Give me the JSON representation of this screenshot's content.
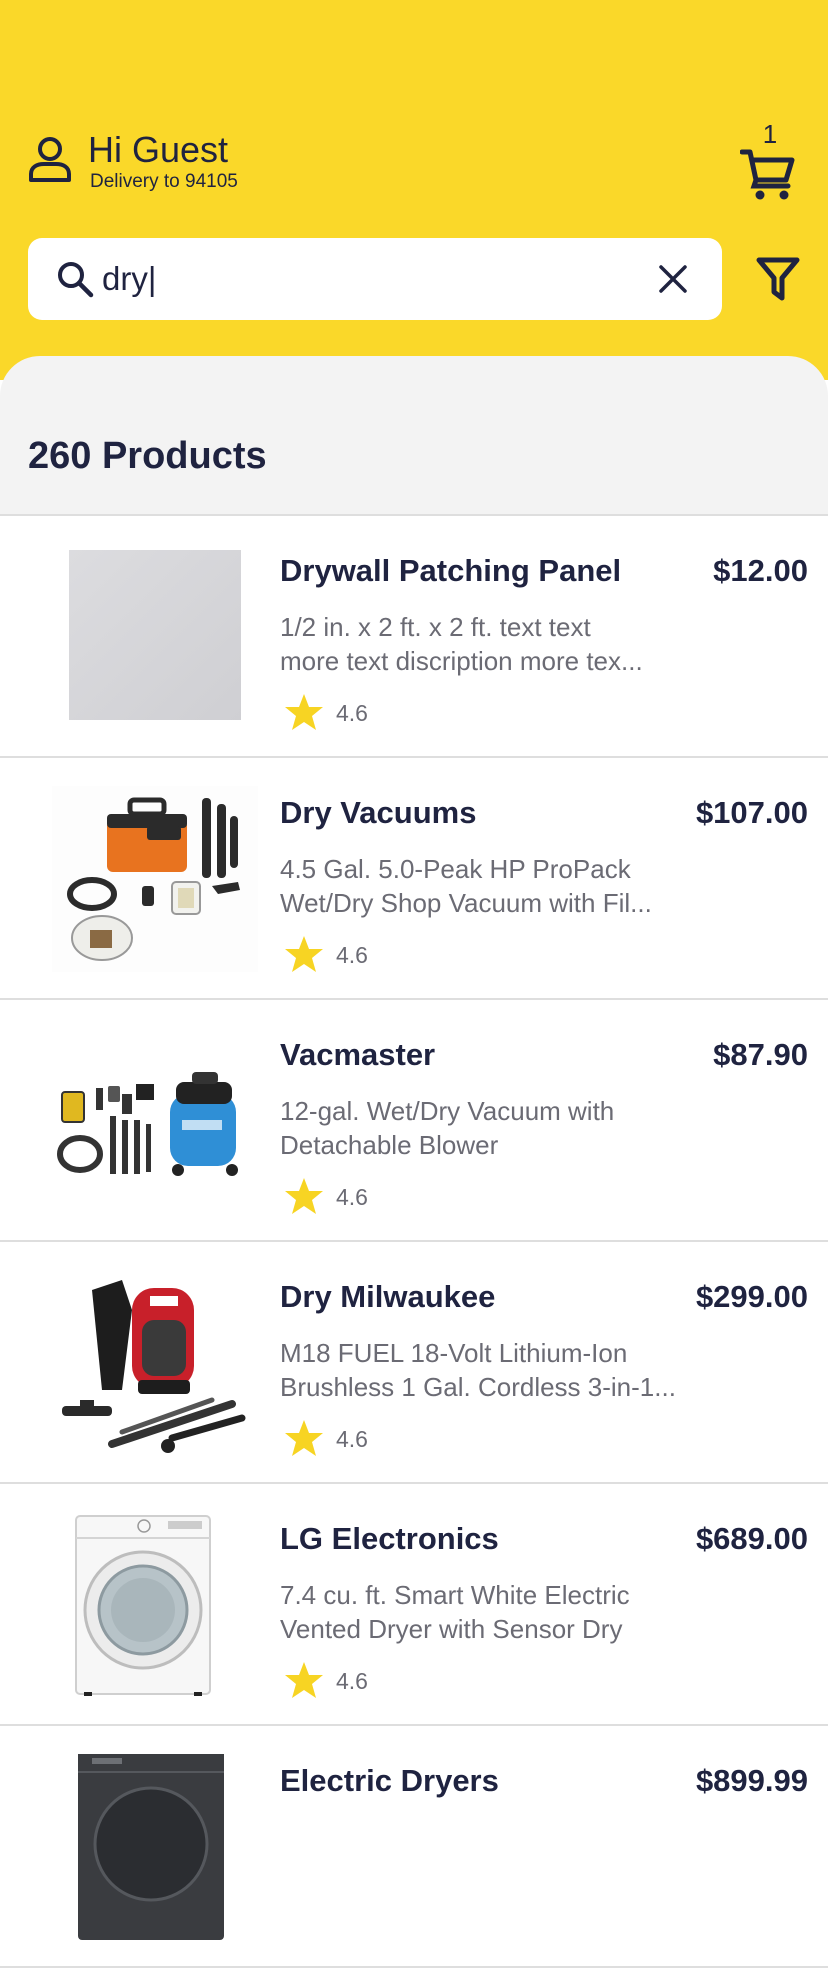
{
  "header": {
    "greeting": "Hi Guest",
    "delivery": "Delivery to 94105",
    "cart_count": "1",
    "background_color": "#fad829"
  },
  "search": {
    "value": "dry|",
    "placeholder": ""
  },
  "results": {
    "count_label": "260 Products"
  },
  "products": [
    {
      "name": "Drywall Patching Panel",
      "price": "$12.00",
      "desc_line1": "1/2 in. x 2 ft. x 2 ft. text text",
      "desc_line2": "more text discription more tex...",
      "rating": "4.6",
      "image": "drywall-panel"
    },
    {
      "name": "Dry Vacuums",
      "price": "$107.00",
      "desc_line1": "4.5 Gal. 5.0-Peak HP ProPack",
      "desc_line2": "Wet/Dry Shop Vacuum with Fil...",
      "rating": "4.6",
      "image": "orange-shop-vacuum"
    },
    {
      "name": "Vacmaster",
      "price": "$87.90",
      "desc_line1": "12-gal. Wet/Dry Vacuum with",
      "desc_line2": "Detachable Blower",
      "rating": "4.6",
      "image": "blue-vacuum-kit"
    },
    {
      "name": "Dry Milwaukee",
      "price": "$299.00",
      "desc_line1": "M18 FUEL 18-Volt Lithium-Ion",
      "desc_line2": "Brushless 1 Gal. Cordless 3-in-1...",
      "rating": "4.6",
      "image": "backpack-vacuum"
    },
    {
      "name": "LG Electronics",
      "price": "$689.00",
      "desc_line1": "7.4 cu. ft. Smart White Electric",
      "desc_line2": "Vented Dryer with Sensor Dry",
      "rating": "4.6",
      "image": "white-dryer"
    },
    {
      "name": "Electric Dryers",
      "price": "$899.99",
      "desc_line1": "",
      "desc_line2": "",
      "rating": "",
      "image": "dark-dryer"
    }
  ],
  "icons": {
    "user": "user-icon",
    "cart": "cart-icon",
    "search": "search-icon",
    "clear": "close-icon",
    "filter": "filter-icon",
    "star": "star-icon"
  },
  "colors": {
    "accent_yellow": "#fad829",
    "text_dark": "#1f2340",
    "text_muted": "#6b6b74",
    "star": "#f7d423"
  }
}
